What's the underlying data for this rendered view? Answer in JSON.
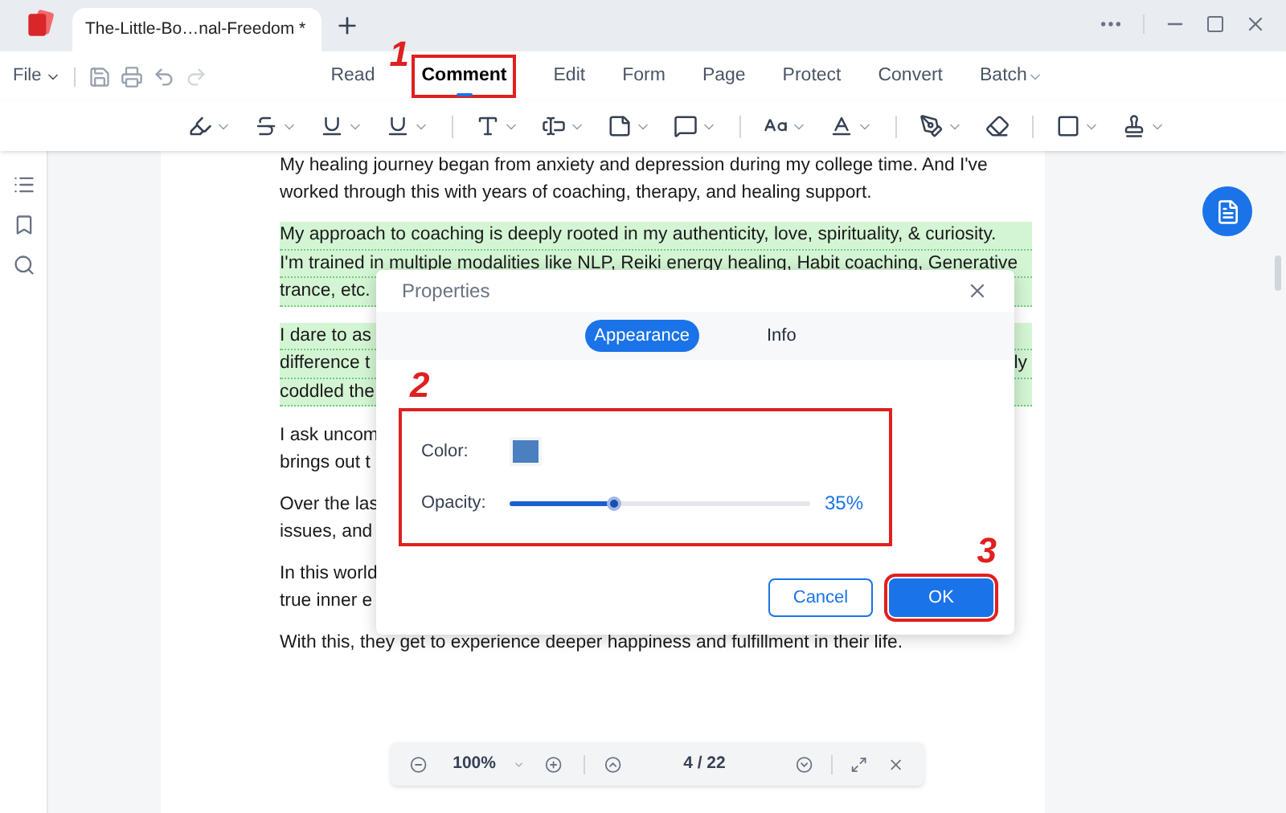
{
  "tab": {
    "title": "The-Little-Bo…nal-Freedom *"
  },
  "menu": {
    "file": "File",
    "tabs": [
      {
        "label": "Read",
        "selected": false
      },
      {
        "label": "Comment",
        "selected": true,
        "callout": "1"
      },
      {
        "label": "Edit",
        "selected": false
      },
      {
        "label": "Form",
        "selected": false
      },
      {
        "label": "Page",
        "selected": false
      },
      {
        "label": "Protect",
        "selected": false
      },
      {
        "label": "Convert",
        "selected": false
      },
      {
        "label": "Batch",
        "selected": false
      }
    ]
  },
  "document": {
    "paragraphs": [
      {
        "highlighted": false,
        "lines": [
          {
            "text": "My healing journey began from anxiety and depression during my college time. And I've"
          },
          {
            "text": "worked through this with years of coaching, therapy, and healing support."
          }
        ]
      },
      {
        "highlighted": true,
        "lines": [
          {
            "text": "My approach to coaching is deeply rooted in my authenticity, love, spirituality, & curiosity."
          },
          {
            "text": "I'm trained in multiple modalities like NLP, Reiki energy healing, Habit coaching, Generative"
          },
          {
            "text": "trance, etc."
          }
        ]
      },
      {
        "highlighted": true,
        "lines": [
          {
            "text": "I dare to as"
          },
          {
            "text": "difference t",
            "text_right": "ly"
          },
          {
            "text": "coddled the"
          }
        ]
      },
      {
        "highlighted": false,
        "lines": [
          {
            "text": "I ask uncom"
          },
          {
            "text": "brings out t"
          }
        ]
      },
      {
        "highlighted": false,
        "lines": [
          {
            "text": "Over the las"
          },
          {
            "text": "issues, and"
          }
        ]
      },
      {
        "highlighted": false,
        "lines": [
          {
            "text": "In this world"
          },
          {
            "text": "true inner e"
          }
        ]
      },
      {
        "highlighted": false,
        "lines": [
          {
            "text": "With this, they get to experience deeper happiness and fulfillment in their life."
          }
        ]
      }
    ]
  },
  "dialog": {
    "title": "Properties",
    "tabs": [
      {
        "label": "Appearance",
        "selected": true
      },
      {
        "label": "Info",
        "selected": false
      }
    ],
    "callout": "2",
    "color_label": "Color:",
    "color": "#4a7fc0",
    "opacity_label": "Opacity:",
    "opacity": {
      "level": 0.35,
      "reading": "35%"
    },
    "buttons": [
      {
        "label": "Cancel",
        "kind": "secondary"
      },
      {
        "label": "OK",
        "kind": "primary",
        "callout": "3"
      }
    ]
  },
  "zoom_bar": {
    "zoom": "100%",
    "page": "4 / 22"
  }
}
